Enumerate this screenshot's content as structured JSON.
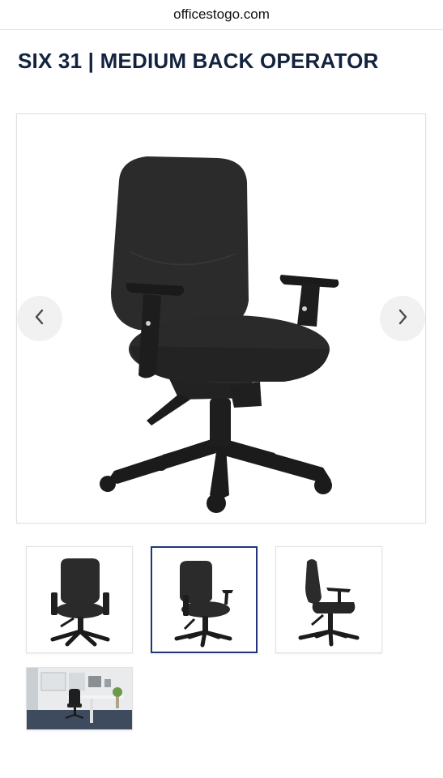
{
  "browser": {
    "url": "officestogo.com"
  },
  "product": {
    "title": "SIX 31 | MEDIUM BACK OPERATOR"
  },
  "gallery": {
    "prev_icon": "chevron-left-icon",
    "next_icon": "chevron-right-icon",
    "selected_thumbnail": 2,
    "thumbnails": [
      {
        "view": "front"
      },
      {
        "view": "three-quarter"
      },
      {
        "view": "side"
      },
      {
        "view": "office-scene"
      }
    ]
  },
  "colors": {
    "title": "#13233f",
    "active_thumb_border": "#24367a",
    "chair": "#2a2a2a"
  }
}
